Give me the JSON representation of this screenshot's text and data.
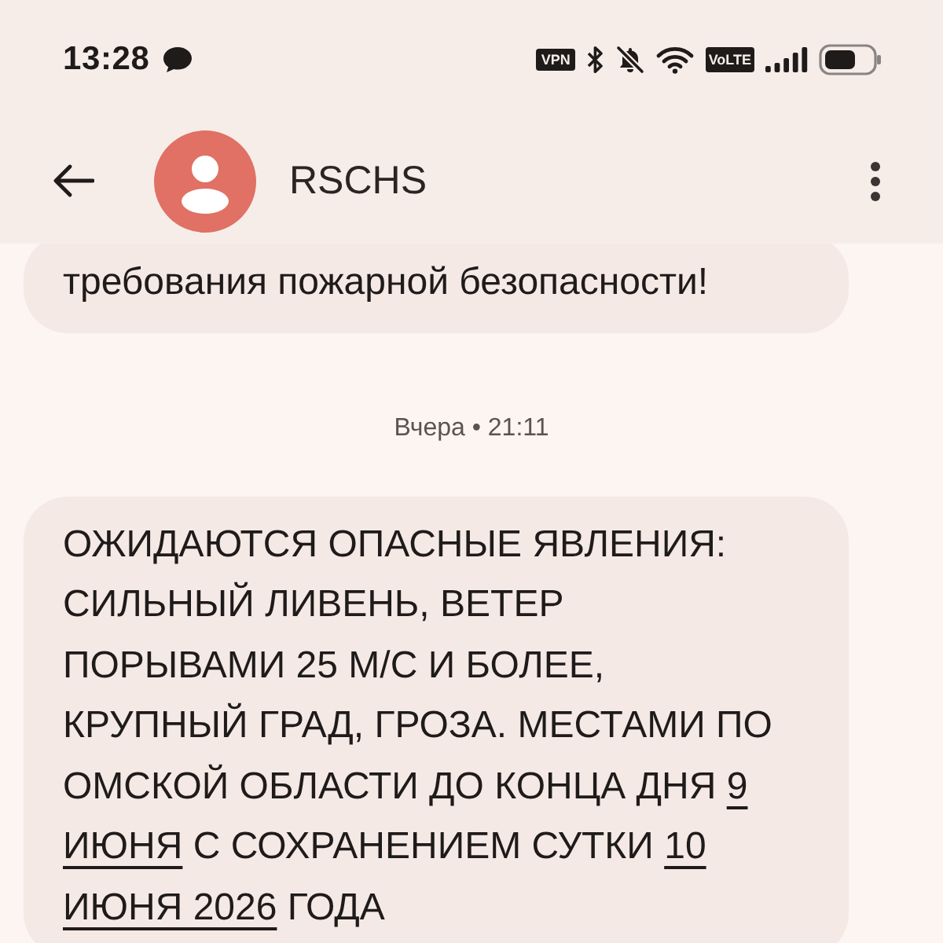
{
  "status_bar": {
    "time": "13:28",
    "vpn_badge": "VPN",
    "volte_badge": "VoLTE"
  },
  "app_bar": {
    "title": "RSCHS"
  },
  "conversation": [
    {
      "kind": "message",
      "segments": [
        {
          "kind": "text",
          "text": "требования пожарной безопасности!"
        }
      ]
    },
    {
      "kind": "timestamp",
      "text": "Вчера • 21:11"
    },
    {
      "kind": "message",
      "segments": [
        {
          "kind": "text",
          "text": "ОЖИДАЮТСЯ ОПАСНЫЕ ЯВЛЕНИЯ: СИЛЬНЫЙ ЛИВЕНЬ, ВЕТЕР ПОРЫВАМИ 25 М/С И БОЛЕЕ, КРУПНЫЙ ГРАД, ГРОЗА. МЕСТАМИ ПО ОМСКОЙ ОБЛАСТИ ДО КОНЦА ДНЯ "
        },
        {
          "kind": "link",
          "text": "9 ИЮНЯ"
        },
        {
          "kind": "text",
          "text": " С СОХРАНЕНИЕМ СУТКИ "
        },
        {
          "kind": "link",
          "text": "10 ИЮНЯ 2026"
        },
        {
          "kind": "text",
          "text": " ГОДА"
        }
      ]
    }
  ]
}
